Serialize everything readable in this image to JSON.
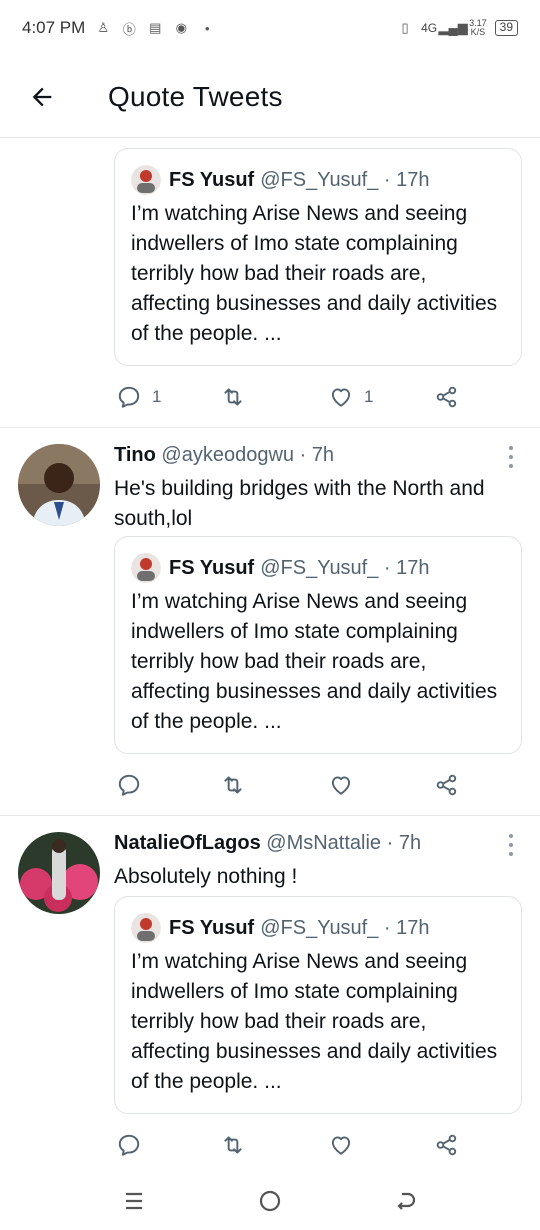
{
  "status_bar": {
    "time": "4:07 PM",
    "network": "4G",
    "speed_value": "3.17",
    "speed_unit": "K/S",
    "battery": "39"
  },
  "header": {
    "title": "Quote Tweets",
    "back_icon": "arrow-left-icon"
  },
  "quoted_tweet": {
    "name": "FS Yusuf",
    "handle": "@FS_Yusuf_ · 17h",
    "text": "I’m watching Arise News and seeing indwellers of Imo state complaining terribly how bad their roads are, affecting businesses and daily activities of the people. ..."
  },
  "tweets": [
    {
      "actions": {
        "reply_count": "1",
        "retweet_count": "",
        "like_count": "1"
      }
    },
    {
      "name": "Tino",
      "handle": "@aykeodogwu · 7h",
      "text": "He's building bridges with the North and south,lol",
      "actions": {
        "reply_count": "",
        "retweet_count": "",
        "like_count": ""
      }
    },
    {
      "name": "NatalieOfLagos",
      "handle": "@MsNattalie · 7h",
      "text": "Absolutely nothing !",
      "actions": {
        "reply_count": "",
        "retweet_count": "",
        "like_count": ""
      }
    }
  ],
  "icons": {
    "reply": "comment-icon",
    "retweet": "retweet-icon",
    "like": "heart-icon",
    "share": "share-icon",
    "more": "more-vertical-icon"
  },
  "colors": {
    "text": "#0f1419",
    "secondary": "#536471",
    "divider": "#e6e6e6"
  }
}
